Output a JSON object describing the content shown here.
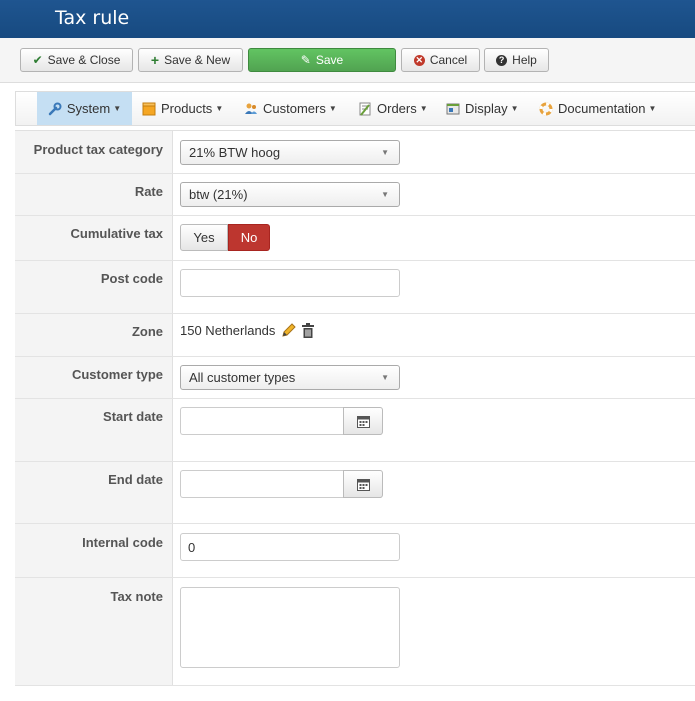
{
  "window": {
    "title": "Tax rule"
  },
  "toolbar": {
    "save_close": "Save & Close",
    "save_new": "Save & New",
    "save": "Save",
    "cancel": "Cancel",
    "help": "Help"
  },
  "menu": {
    "items": [
      {
        "label": "System",
        "icon": "wrench-icon"
      },
      {
        "label": "Products",
        "icon": "box-icon"
      },
      {
        "label": "Customers",
        "icon": "users-icon"
      },
      {
        "label": "Orders",
        "icon": "orders-icon"
      },
      {
        "label": "Display",
        "icon": "display-icon"
      },
      {
        "label": "Documentation",
        "icon": "lifebuoy-icon"
      }
    ]
  },
  "form": {
    "product_tax_category": {
      "label": "Product tax category",
      "value": "21% BTW hoog"
    },
    "rate": {
      "label": "Rate",
      "value": "btw (21%)"
    },
    "cumulative_tax": {
      "label": "Cumulative tax",
      "yes": "Yes",
      "no": "No",
      "selected": "No"
    },
    "post_code": {
      "label": "Post code",
      "value": ""
    },
    "zone": {
      "label": "Zone",
      "value": "150 Netherlands"
    },
    "customer_type": {
      "label": "Customer type",
      "value": "All customer types"
    },
    "start_date": {
      "label": "Start date",
      "value": ""
    },
    "end_date": {
      "label": "End date",
      "value": ""
    },
    "internal_code": {
      "label": "Internal code",
      "value": "0"
    },
    "tax_note": {
      "label": "Tax note",
      "value": ""
    }
  },
  "colors": {
    "header": "#1f5590",
    "save_green": "#51a351",
    "no_red": "#bd362f",
    "menu_active": "#c5dff3"
  }
}
